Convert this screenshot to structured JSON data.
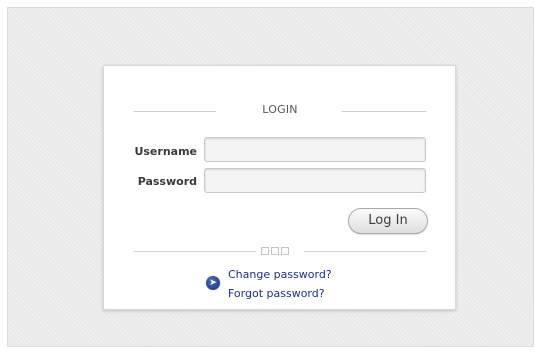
{
  "login": {
    "title": "LOGIN",
    "username_label": "Username",
    "username_value": "",
    "password_label": "Password",
    "password_value": "",
    "submit_label": "Log In",
    "separator_icon": "three-squares",
    "links_icon": "blue-arrow-circle-icon",
    "change_password_label": "Change password?",
    "forgot_password_label": "Forgot password?"
  },
  "colors": {
    "background": "#e9e9e9",
    "panel": "#ffffff",
    "link": "#1f2f8a",
    "icon": "#1f3a8f"
  }
}
